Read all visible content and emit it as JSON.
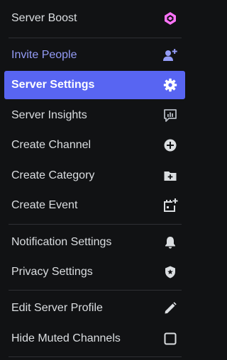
{
  "menu": {
    "items": [
      {
        "label": "Server Boost",
        "icon": "boost-gem-icon"
      },
      {
        "label": "Invite People",
        "icon": "add-person-icon"
      },
      {
        "label": "Server Settings",
        "icon": "gear-icon"
      },
      {
        "label": "Server Insights",
        "icon": "insights-chart-icon"
      },
      {
        "label": "Create Channel",
        "icon": "plus-circle-icon"
      },
      {
        "label": "Create Category",
        "icon": "folder-plus-icon"
      },
      {
        "label": "Create Event",
        "icon": "calendar-plus-icon"
      },
      {
        "label": "Notification Settings",
        "icon": "bell-icon"
      },
      {
        "label": "Privacy Settings",
        "icon": "shield-icon"
      },
      {
        "label": "Edit Server Profile",
        "icon": "pencil-icon"
      },
      {
        "label": "Hide Muted Channels",
        "icon": "checkbox-icon",
        "checked": false
      }
    ]
  },
  "colors": {
    "background": "#111214",
    "text": "#dbdee1",
    "accent_text": "#949cf7",
    "selected_background": "#5865f2",
    "boost_pink": "#ff73fa",
    "icon": "#b5bac1"
  }
}
